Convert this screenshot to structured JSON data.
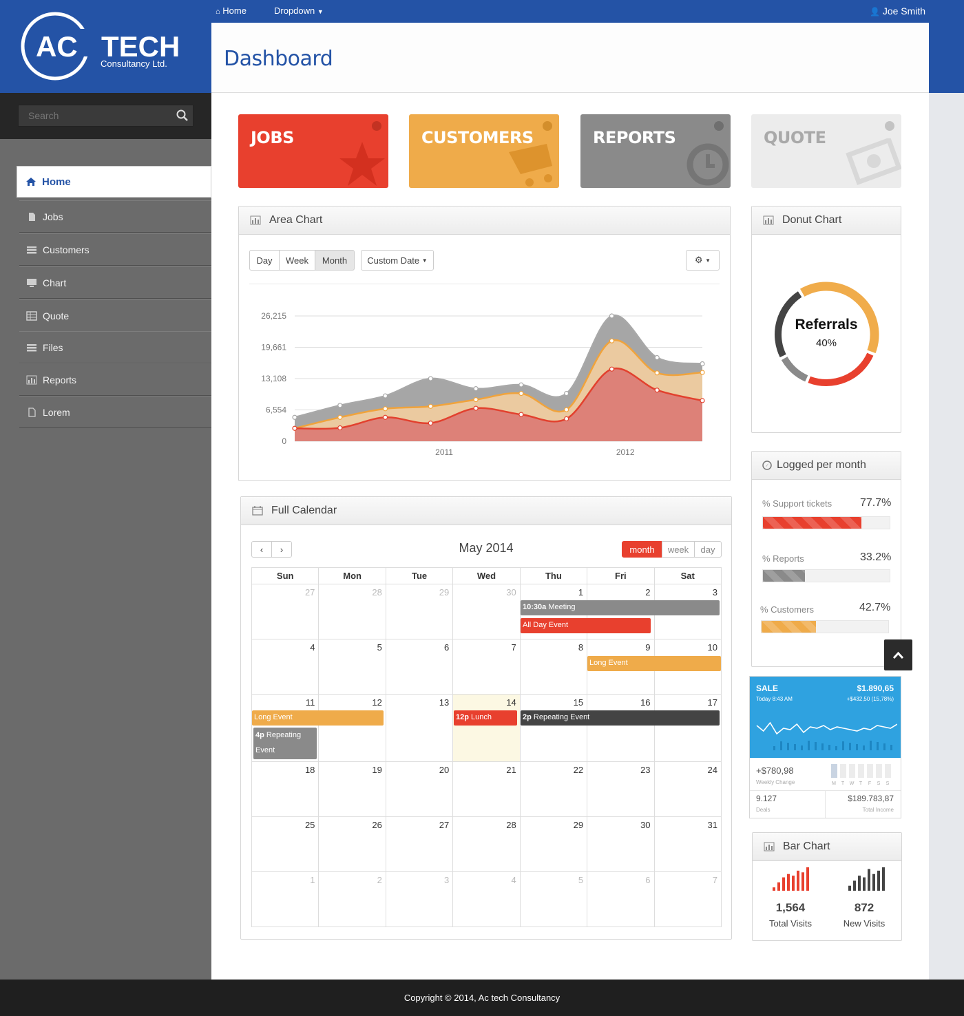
{
  "brand": {
    "logo_main": "AC TECH",
    "logo_ac": "AC",
    "logo_tech": "TECH",
    "logo_sub": "Consultancy Ltd."
  },
  "topnav": {
    "home": "Home",
    "dropdown": "Dropdown",
    "user": "Joe Smith"
  },
  "header": {
    "title": "Dashboard"
  },
  "search": {
    "placeholder": "Search"
  },
  "sidebar": {
    "items": [
      {
        "label": "Home",
        "icon": "home-icon"
      },
      {
        "label": "Jobs",
        "icon": "file-icon"
      },
      {
        "label": "Customers",
        "icon": "list-icon"
      },
      {
        "label": "Chart",
        "icon": "monitor-icon"
      },
      {
        "label": "Quote",
        "icon": "table-icon"
      },
      {
        "label": "Files",
        "icon": "list-icon"
      },
      {
        "label": "Reports",
        "icon": "bar-chart-icon"
      },
      {
        "label": "Lorem",
        "icon": "file-icon"
      }
    ]
  },
  "tiles": [
    {
      "label": "JOBS",
      "color": "#e8402e",
      "icon": "star-icon"
    },
    {
      "label": "CUSTOMERS",
      "color": "#efab4a",
      "icon": "cart-icon"
    },
    {
      "label": "REPORTS",
      "color": "#8a8a8a",
      "icon": "clock-icon"
    },
    {
      "label": "QUOTE",
      "color": "#ececec",
      "icon": "money-icon"
    }
  ],
  "area_chart": {
    "title": "Area Chart",
    "range_buttons": [
      "Day",
      "Week",
      "Month"
    ],
    "active_range": "Month",
    "custom_date": "Custom Date"
  },
  "chart_data": {
    "type": "area",
    "x": [
      0,
      1,
      2,
      3,
      4,
      5,
      6,
      7,
      8,
      9
    ],
    "categories_labels": [
      "2011",
      "2012"
    ],
    "yticks": [
      "26,215",
      "19,661",
      "13,108",
      "6,554",
      "0"
    ],
    "ylim": [
      0,
      26215
    ],
    "series": [
      {
        "color": "#a8a8a8",
        "values": [
          5000,
          7500,
          9500,
          13100,
          11000,
          11800,
          10000,
          26215,
          17500,
          16200
        ]
      },
      {
        "color": "#f0a33c",
        "values": [
          2700,
          5000,
          6800,
          7300,
          8700,
          10000,
          6600,
          21000,
          14300,
          14400
        ]
      },
      {
        "color": "#e2412e",
        "values": [
          2700,
          2800,
          5000,
          3800,
          6900,
          5600,
          4700,
          15100,
          10700,
          8500
        ]
      }
    ]
  },
  "donut": {
    "title": "Donut Chart",
    "label": "Referrals",
    "value": "40%",
    "segments": [
      {
        "pct": 40,
        "color": "#f0ac4b"
      },
      {
        "pct": 25,
        "color": "#e8402e"
      },
      {
        "pct": 11,
        "color": "#8a8a8a"
      },
      {
        "pct": 24,
        "color": "#444444"
      }
    ]
  },
  "logged": {
    "title": "Logged per month",
    "items": [
      {
        "label": "Support tickets",
        "value": "77.7%",
        "pct": 77.7,
        "color": "#e8402e"
      },
      {
        "label": "Reports",
        "value": "33.2%",
        "pct": 33.2,
        "color": "#8a8a8a"
      },
      {
        "label": "Customers",
        "value": "42.7%",
        "pct": 42.7,
        "color": "#efab4a"
      }
    ]
  },
  "sale": {
    "label": "SALE",
    "amount": "$1.890,65",
    "time": "Today 8:43 AM",
    "change": "+$432,50 (15,78%)",
    "weekly_value": "+$780,98",
    "weekly_label": "Weekly Change",
    "days": [
      "M",
      "T",
      "W",
      "T",
      "F",
      "S",
      "S"
    ],
    "deals_value": "9.127",
    "deals_label": "Deals",
    "income_value": "$189.783,87",
    "income_label": "Total Income",
    "line": [
      12,
      8,
      14,
      6,
      10,
      9,
      13,
      7,
      11,
      10,
      12,
      9,
      11,
      10,
      9,
      8,
      10,
      9,
      12,
      11,
      10,
      13
    ]
  },
  "calendar": {
    "title": "Full Calendar",
    "month": "May 2014",
    "views": [
      "month",
      "week",
      "day"
    ],
    "active_view": "month",
    "weekdays": [
      "Sun",
      "Mon",
      "Tue",
      "Wed",
      "Thu",
      "Fri",
      "Sat"
    ],
    "weeks": [
      [
        "27",
        "28",
        "29",
        "30",
        "1",
        "2",
        "3"
      ],
      [
        "4",
        "5",
        "6",
        "7",
        "8",
        "9",
        "10"
      ],
      [
        "11",
        "12",
        "13",
        "14",
        "15",
        "16",
        "17"
      ],
      [
        "18",
        "19",
        "20",
        "21",
        "22",
        "23",
        "24"
      ],
      [
        "25",
        "26",
        "27",
        "28",
        "29",
        "30",
        "31"
      ],
      [
        "1",
        "2",
        "3",
        "4",
        "5",
        "6",
        "7"
      ]
    ],
    "events": {
      "meeting_time": "10:30a",
      "meeting": "Meeting",
      "allday": "All Day Event",
      "long1": "Long Event",
      "long2": "Long Event",
      "rep1_time": "4p",
      "rep1": "Repeating Event",
      "lunch_time": "12p",
      "lunch": "Lunch",
      "rep2_time": "2p",
      "rep2": "Repeating Event"
    }
  },
  "bar_chart": {
    "title": "Bar Chart",
    "left": {
      "value": "1,564",
      "label": "Total Visits",
      "bars": [
        2,
        5,
        8,
        10,
        9,
        12,
        11,
        14
      ]
    },
    "right": {
      "value": "872",
      "label": "New Visits",
      "bars": [
        3,
        6,
        9,
        8,
        13,
        10,
        12,
        14
      ]
    }
  },
  "footer": {
    "text": "Copyright © 2014, Ac tech Consultancy"
  }
}
